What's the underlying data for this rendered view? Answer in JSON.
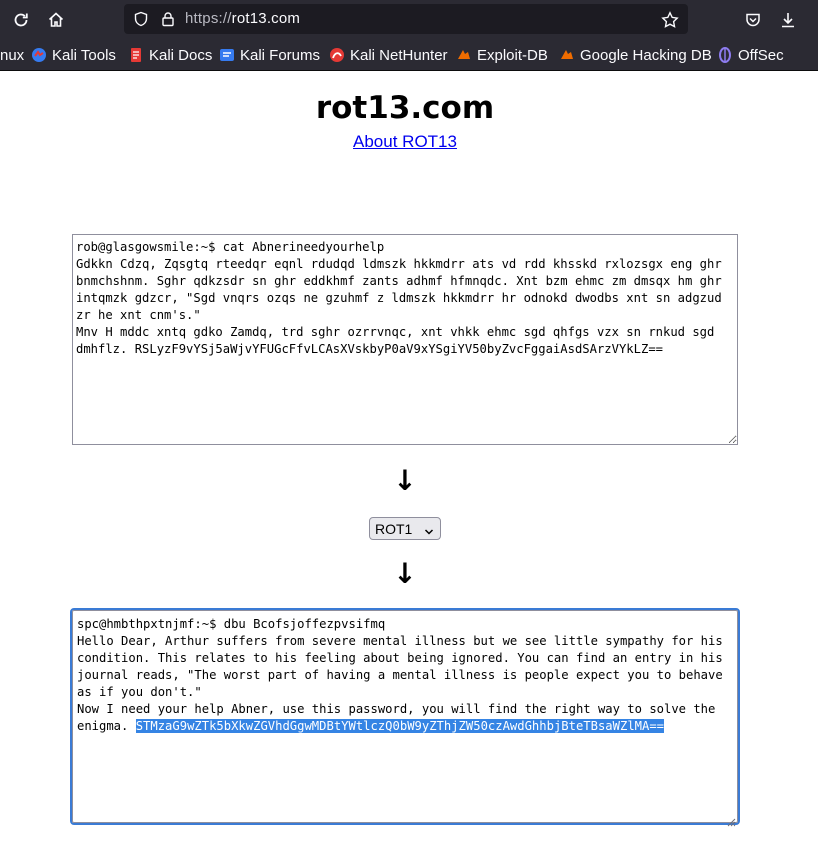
{
  "browser": {
    "url_scheme": "https://",
    "url_host": "rot13.com",
    "bookmarks": [
      {
        "label": "nux",
        "icon": "kali-linux-icon"
      },
      {
        "label": "Kali Tools",
        "icon": "kali-tools-icon"
      },
      {
        "label": "Kali Docs",
        "icon": "kali-docs-icon"
      },
      {
        "label": "Kali Forums",
        "icon": "kali-forums-icon"
      },
      {
        "label": "Kali NetHunter",
        "icon": "nethunter-icon"
      },
      {
        "label": "Exploit-DB",
        "icon": "exploit-db-icon"
      },
      {
        "label": "Google Hacking DB",
        "icon": "ghdb-icon"
      },
      {
        "label": "OffSec",
        "icon": "offsec-icon"
      }
    ]
  },
  "page": {
    "title": "rot13.com",
    "about_link": "About ROT13",
    "input_text": "rob@glasgowsmile:~$ cat Abnerineedyourhelp\nGdkkn Cdzq, Zqsgtq rteedqr eqnl rdudqd ldmszk hkkmdrr ats vd rdd khsskd rxlozsgx eng ghr bnmchshnm. Sghr qdkzsdr sn ghr eddkhmf zants adhmf hfmnqdc. Xnt bzm ehmc zm dmsqx hm ghr intqmzk gdzcr, \"Sgd vnqrs ozqs ne gzuhmf z ldmszk hkkmdrr hr odnokd dwodbs xnt sn adgzud zr he xnt cnm's.\"\nMnv H mddc xntq gdko Zamdq, trd sghr ozrrvnqc, xnt vhkk ehmc sgd qhfgs vzx sn rnkud sgd dmhflz. RSLyzF9vYSj5aWjvYFUGcFfvLCAsXVskbyP0aV9xYSgiYV50byZvcFggaiAsdSArzVYkLZ==",
    "arrow_glyph": "↓",
    "cipher_select": "ROT1",
    "output_prefix": "spc@hmbthpxtnjmf:~$ dbu Bcofsjoffezpvsifmq\nHello Dear, Arthur suffers from severe mental illness but we see little sympathy for his condition. This relates to his feeling about being ignored. You can find an entry in his journal reads, \"The worst part of having a mental illness is people expect you to behave as if you don't.\"\nNow I need your help Abner, use this password, you will find the right way to solve the enigma. ",
    "output_selected": "STMzaG9wZTk5bXkwZGVhdGgwMDBtYWtlczQ0bW9yZThjZW50czAwdGhhbjBteTBsaWZlMA=="
  }
}
